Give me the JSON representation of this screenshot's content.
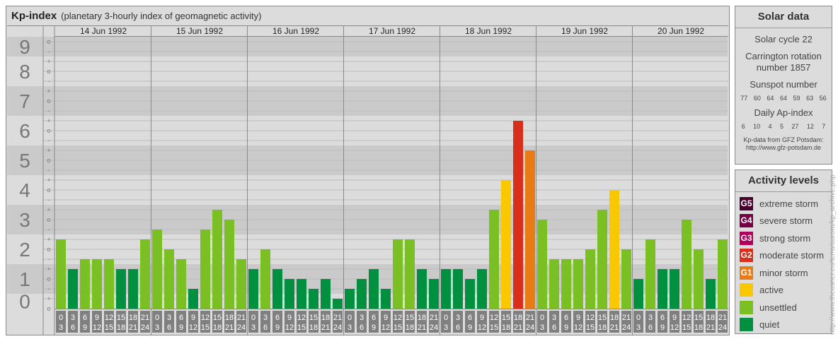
{
  "title": {
    "main": "Kp-index",
    "sub": "(planetary 3-hourly index of geomagnetic activity)"
  },
  "chart_data": {
    "type": "bar",
    "title": "Kp-index",
    "ylabel": "Kp",
    "ylim": [
      0,
      9
    ],
    "y_ticks": [
      "0",
      "1",
      "2",
      "3",
      "4",
      "5",
      "6",
      "7",
      "8",
      "9"
    ],
    "sub_ticks": [
      "-",
      "o",
      "+"
    ],
    "days": [
      "14 Jun 1992",
      "15 Jun 1992",
      "16 Jun 1992",
      "17 Jun 1992",
      "18 Jun 1992",
      "19 Jun 1992",
      "20 Jun 1992"
    ],
    "intervals": [
      [
        "0",
        "3"
      ],
      [
        "3",
        "6"
      ],
      [
        "6",
        "9"
      ],
      [
        "9",
        "12"
      ],
      [
        "12",
        "15"
      ],
      [
        "15",
        "18"
      ],
      [
        "18",
        "21"
      ],
      [
        "21",
        "24"
      ]
    ],
    "values": [
      [
        "2+",
        "1+",
        "2-",
        "2-",
        "2-",
        "1+",
        "1+",
        "2+"
      ],
      [
        "3-",
        "2o",
        "2-",
        "1-",
        "3-",
        "3+",
        "3o",
        "2-"
      ],
      [
        "1+",
        "2o",
        "1+",
        "1o",
        "1o",
        "1-",
        "1o",
        "0+"
      ],
      [
        "1-",
        "1o",
        "1+",
        "1-",
        "2+",
        "2+",
        "1+",
        "1o"
      ],
      [
        "1+",
        "1+",
        "1o",
        "1+",
        "3+",
        "4+",
        "6+",
        "5+"
      ],
      [
        "3o",
        "2-",
        "2-",
        "2-",
        "2o",
        "3+",
        "4o",
        "2o"
      ],
      [
        "1o",
        "2+",
        "1+",
        "1+",
        "3o",
        "2o",
        "1o",
        "2+"
      ]
    ]
  },
  "solar": {
    "header": "Solar data",
    "cycle": "Solar cycle 22",
    "carrington": "Carrington rotation number 1857",
    "sunspot_label": "Sunspot number",
    "sunspots": [
      "77",
      "60",
      "64",
      "64",
      "59",
      "63",
      "56"
    ],
    "ap_label": "Daily Ap-index",
    "ap": [
      "6",
      "10",
      "4",
      "5",
      "27",
      "12",
      "7"
    ],
    "source1": "Kp-data from GFZ Potsdam:",
    "source2": "http://www.gfz-potsdam.de"
  },
  "activity": {
    "header": "Activity levels",
    "levels": [
      {
        "code": "G5",
        "label": "extreme storm",
        "color": "#4a0030"
      },
      {
        "code": "G4",
        "label": "severe storm",
        "color": "#760045"
      },
      {
        "code": "G3",
        "label": "strong storm",
        "color": "#b0005c"
      },
      {
        "code": "G2",
        "label": "moderate storm",
        "color": "#d92e1c"
      },
      {
        "code": "G1",
        "label": "minor storm",
        "color": "#e87b14"
      },
      {
        "code": "",
        "label": "active",
        "color": "#fac800"
      },
      {
        "code": "",
        "label": "unsettled",
        "color": "#7ac023"
      },
      {
        "code": "",
        "label": "quiet",
        "color": "#009040"
      }
    ]
  },
  "url": "http://www.theusner.eu/terra/aurora/kp_archive.php"
}
